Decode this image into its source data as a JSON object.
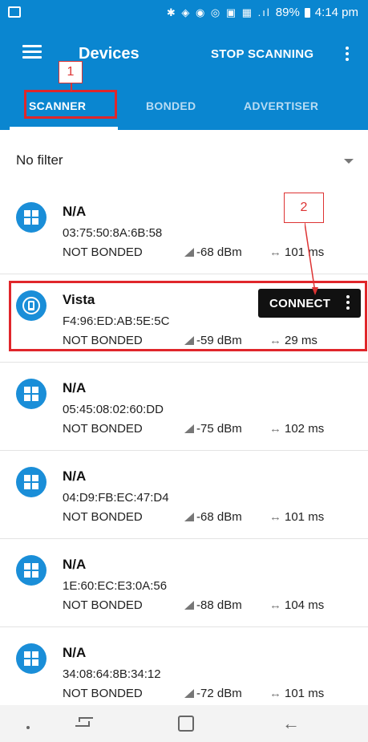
{
  "status_bar": {
    "icons": "✱ ◈ ◉ ◎ ▣ ▦ .ıl",
    "battery": "89%",
    "time": "4:14 pm"
  },
  "app_bar": {
    "title": "Devices",
    "stop_scanning": "STOP SCANNING"
  },
  "tabs": [
    {
      "label": "SCANNER",
      "active": true
    },
    {
      "label": "BONDED",
      "active": false
    },
    {
      "label": "ADVERTISER",
      "active": false
    }
  ],
  "annotations": [
    "1",
    "2"
  ],
  "filter": {
    "label": "No filter"
  },
  "devices": [
    {
      "name": "N/A",
      "mac": "03:75:50:8A:6B:58",
      "bond": "NOT BONDED",
      "rssi": "-68 dBm",
      "interval": "101 ms"
    },
    {
      "name": "Vista",
      "mac": "F4:96:ED:AB:5E:5C",
      "bond": "NOT BONDED",
      "rssi": "-59 dBm",
      "interval": "29 ms",
      "connect": "CONNECT"
    },
    {
      "name": "N/A",
      "mac": "05:45:08:02:60:DD",
      "bond": "NOT BONDED",
      "rssi": "-75 dBm",
      "interval": "102 ms"
    },
    {
      "name": "N/A",
      "mac": "04:D9:FB:EC:47:D4",
      "bond": "NOT BONDED",
      "rssi": "-68 dBm",
      "interval": "101 ms"
    },
    {
      "name": "N/A",
      "mac": "1E:60:EC:E3:0A:56",
      "bond": "NOT BONDED",
      "rssi": "-88 dBm",
      "interval": "104 ms"
    },
    {
      "name": "N/A",
      "mac": "34:08:64:8B:34:12",
      "bond": "NOT BONDED",
      "rssi": "-72 dBm",
      "interval": "101 ms"
    }
  ],
  "colors": {
    "primary": "#0a86d0",
    "device_icon": "#1a8ed8",
    "annotation": "#e0262b"
  }
}
